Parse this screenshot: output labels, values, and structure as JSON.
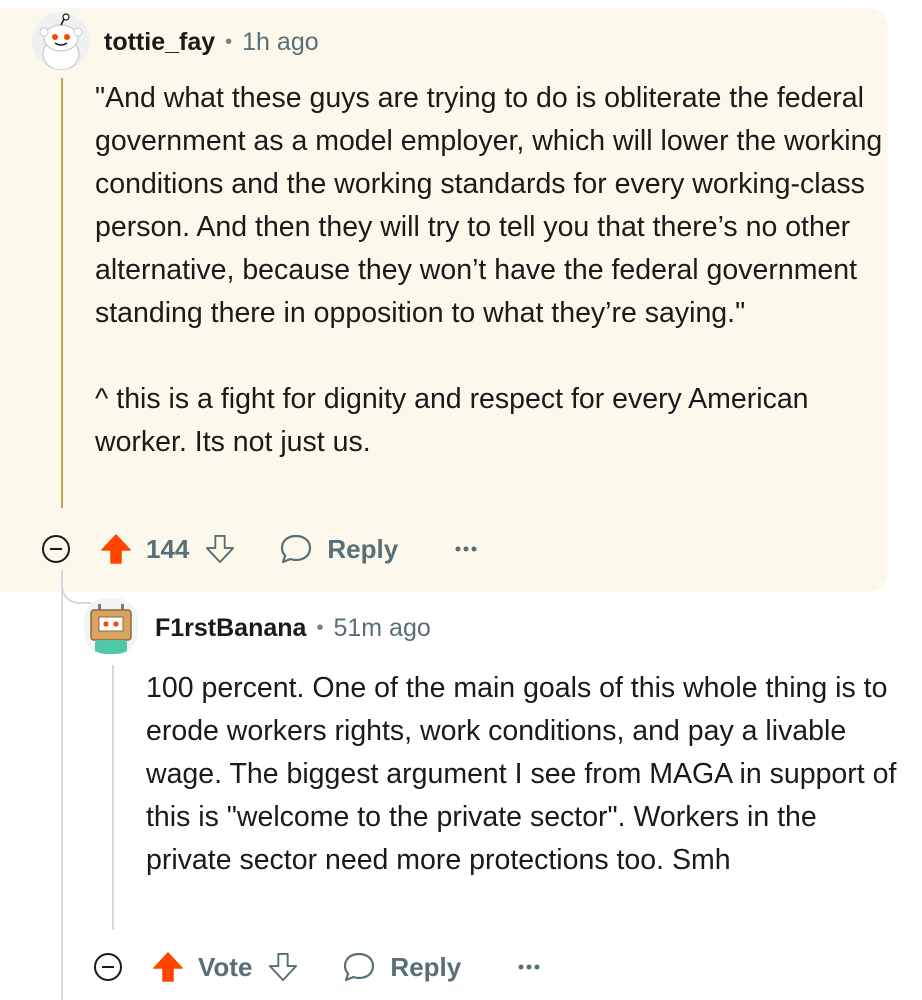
{
  "comments": [
    {
      "username": "tottie_fay",
      "separator": "•",
      "time": "1h ago",
      "paragraphs": [
        "\"And what these guys are trying to do is obliterate the federal government as a model employer, which will lower the working conditions and the working standards for every working-class person. And then they will try to tell you that there’s no other alternative, because they won’t have the federal government standing there in opposition to what they’re saying.\"",
        "^ this is a fight for dignity and respect for every American worker. Its not just us."
      ],
      "vote_label": "144",
      "upvoted": true,
      "reply_label": "Reply",
      "highlighted": true
    },
    {
      "username": "F1rstBanana",
      "separator": "•",
      "time": "51m ago",
      "paragraphs": [
        "100 percent. One of the main goals of this whole thing is to erode workers rights, work conditions, and pay a livable wage. The biggest argument I see from MAGA in support of this is \"welcome to the private sector\". Workers in the private sector need more protections too. Smh"
      ],
      "vote_label": "Vote",
      "upvoted": true,
      "reply_label": "Reply",
      "highlighted": false
    }
  ],
  "icons": {
    "collapse": "collapse-icon",
    "upvote": "upvote-arrow-icon",
    "downvote": "downvote-arrow-icon",
    "reply": "speech-bubble-icon",
    "more": "ellipsis-icon"
  },
  "colors": {
    "highlight_bg": "#fdf8ec",
    "highlight_thread": "#c9a24d",
    "upvote": "#ff4500",
    "muted": "#576f76"
  }
}
